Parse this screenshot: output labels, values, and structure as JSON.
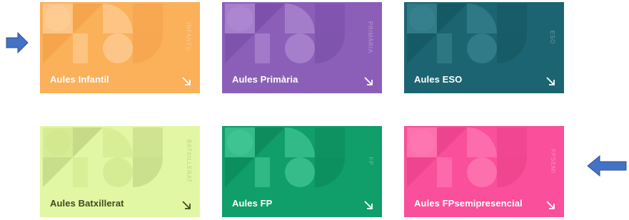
{
  "cards": [
    {
      "label": "Aules Infantil",
      "side": "INFANTIL",
      "color": "#fbb05a",
      "shade": "#f29a3e",
      "light": "#ffd6a6"
    },
    {
      "label": "Aules Primària",
      "side": "PRIMÀRIA",
      "color": "#8b5fb8",
      "shade": "#6f449e",
      "light": "#b995d9"
    },
    {
      "label": "Aules ESO",
      "side": "ESO",
      "color": "#1c6471",
      "shade": "#0e4d58",
      "light": "#3e8a96"
    },
    {
      "label": "Aules Batxillerat",
      "side": "BATXILLERAT",
      "color": "#e2f7a4",
      "shade": "#a9bf6a",
      "light": "#cde58a"
    },
    {
      "label": "Aules FP",
      "side": "FP",
      "color": "#109e6a",
      "shade": "#0b7a51",
      "light": "#4fd1a0"
    },
    {
      "label": "Aules FPsemipresencial",
      "side": "FPSEMI",
      "color": "#fa4f9a",
      "shade": "#e03a83",
      "light": "#ff85bb"
    }
  ],
  "pointers": {
    "left": {
      "icon": "arrow-right-icon",
      "color": "#4472c4"
    },
    "right": {
      "icon": "arrow-left-icon",
      "color": "#4472c4"
    }
  },
  "icons": {
    "card_arrow": "arrow-down-right-icon"
  }
}
